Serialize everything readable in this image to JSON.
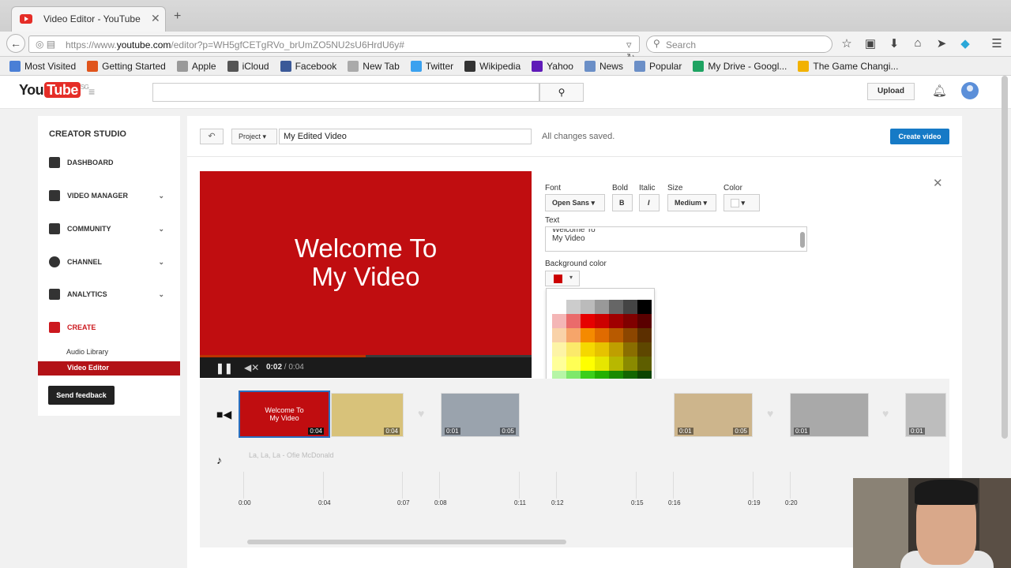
{
  "browser": {
    "tab_title": "Video Editor - YouTube",
    "url_host": "https://www.",
    "url_domain": "youtube.com",
    "url_path": "/editor?p=WH5gfCETgRVo_brUmZO5NU2sU6HrdU6y#",
    "search_placeholder": "Search",
    "bookmarks": [
      {
        "label": "Most Visited",
        "color": "#4a7fd6"
      },
      {
        "label": "Getting Started",
        "color": "#e0541c"
      },
      {
        "label": "Apple",
        "color": "#999999"
      },
      {
        "label": "iCloud",
        "color": "#555555"
      },
      {
        "label": "Facebook",
        "color": "#3b5998"
      },
      {
        "label": "New Tab",
        "color": "#aaaaaa"
      },
      {
        "label": "Twitter",
        "color": "#3aa1ef"
      },
      {
        "label": "Wikipedia",
        "color": "#333333"
      },
      {
        "label": "Yahoo",
        "color": "#5f1ab8"
      },
      {
        "label": "News",
        "color": "#6b8fc7"
      },
      {
        "label": "Popular",
        "color": "#6b8fc7"
      },
      {
        "label": "My Drive - Googl...",
        "color": "#1ea362"
      },
      {
        "label": "The Game Changi...",
        "color": "#f2b200"
      }
    ]
  },
  "youtube": {
    "logo_you": "You",
    "logo_tube": "Tube",
    "logo_region": "SG",
    "upload_label": "Upload"
  },
  "sidebar": {
    "title": "CREATOR STUDIO",
    "items": [
      {
        "label": "DASHBOARD"
      },
      {
        "label": "VIDEO MANAGER"
      },
      {
        "label": "COMMUNITY"
      },
      {
        "label": "CHANNEL"
      },
      {
        "label": "ANALYTICS"
      },
      {
        "label": "CREATE"
      }
    ],
    "sub_items": [
      "Audio Library",
      "Video Editor"
    ],
    "feedback_label": "Send feedback"
  },
  "editor": {
    "project_label": "Project",
    "project_name": "My Edited Video",
    "saved_status": "All changes saved.",
    "create_label": "Create video",
    "preview_title_line1": "Welcome To",
    "preview_title_line2": "My Video",
    "time_current": "0:02",
    "time_total": "/ 0:04",
    "progress_fraction": 0.5
  },
  "text_panel": {
    "font_label": "Font",
    "font_value": "Open Sans",
    "bold_label": "Bold",
    "italic_label": "Italic",
    "size_label": "Size",
    "size_value": "Medium",
    "color_label": "Color",
    "text_label": "Text",
    "text_line1": "Welcome To",
    "text_line2": "My Video",
    "bg_color_label": "Background color",
    "bg_color_value": "#cc0000",
    "palette": [
      [
        "#ffffff",
        "#cccccc",
        "#bbbbbb",
        "#999999",
        "#666666",
        "#444444",
        "#000000"
      ],
      [
        "#f4b6b6",
        "#ea6b6b",
        "#e60000",
        "#cc0000",
        "#a00000",
        "#800000",
        "#5a0000"
      ],
      [
        "#f9d2a8",
        "#f6a56a",
        "#f58a00",
        "#e06b00",
        "#b85a00",
        "#8c4600",
        "#5c2f00"
      ],
      [
        "#fdf4a6",
        "#fbe96a",
        "#f5d800",
        "#e6c200",
        "#bf9f00",
        "#8a6e00",
        "#5e4700"
      ],
      [
        "#ffff99",
        "#ffff55",
        "#ffff00",
        "#e6e600",
        "#b8b800",
        "#8a8a00",
        "#5e5e00"
      ],
      [
        "#b6f5a6",
        "#7ee86a",
        "#3ccf1a",
        "#22b000",
        "#1a8a00",
        "#136600",
        "#0c4400"
      ],
      [
        "#a6f5f5",
        "#6ae8e0",
        "#1acfc0",
        "#00b0a0",
        "#008a7e",
        "#00665e",
        "#004440"
      ],
      [
        "#a6e0f5",
        "#6ac8f0",
        "#1aa8e8",
        "#0088d0",
        "#0066a8",
        "#004d80",
        "#003358"
      ],
      [
        "#b6c6f5",
        "#7a96ef",
        "#3a5ee8",
        "#1a3ad0",
        "#1026a8",
        "#0a1a80",
        "#060f58"
      ],
      [
        "#e6b6f5",
        "#cc7aef",
        "#a83ae8",
        "#8a1ad0",
        "#6a10a8",
        "#4e0a80",
        "#330658"
      ]
    ]
  },
  "timeline": {
    "clip_title_line1": "Welcome To",
    "clip_title_line2": "My Video",
    "clip_duration": "0:04",
    "clip_durations": [
      "0:04",
      "0:01",
      "0:05",
      "0:01",
      "0:05",
      "0:01",
      "0:01"
    ],
    "audio_track": "La, La, La - Ofie McDonald",
    "ticks": [
      "0:00",
      "0:04",
      "0:07",
      "0:08",
      "0:11",
      "0:12",
      "0:15",
      "0:16",
      "0:19",
      "0:20"
    ]
  }
}
